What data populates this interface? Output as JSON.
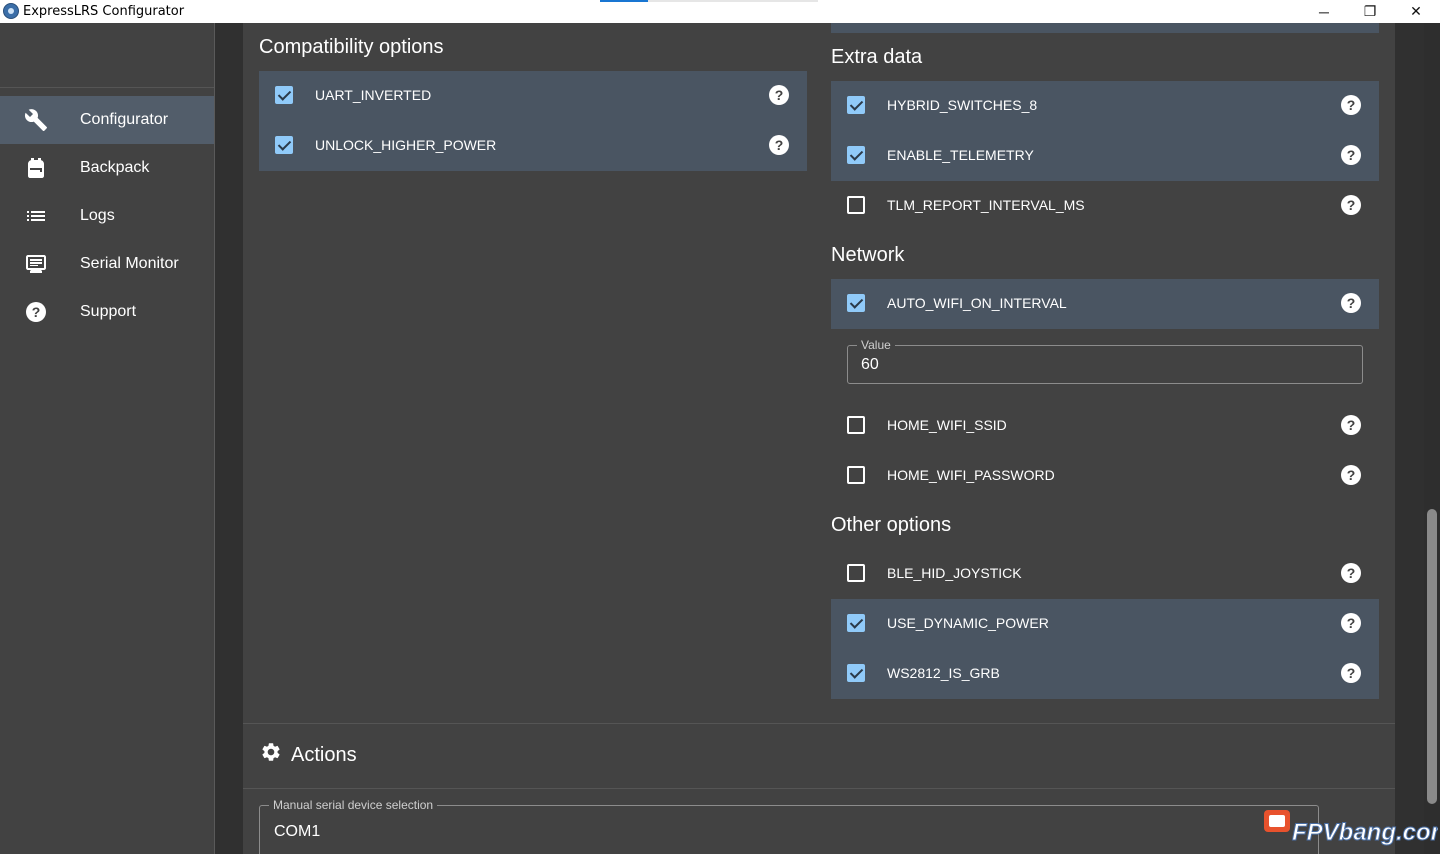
{
  "window": {
    "title": "ExpressLRS Configurator",
    "minimize": "─",
    "maximize": "❐",
    "close": "✕"
  },
  "sidebar": {
    "items": [
      {
        "label": "Configurator",
        "icon": "wrench-icon",
        "active": true
      },
      {
        "label": "Backpack",
        "icon": "backpack-icon",
        "active": false
      },
      {
        "label": "Logs",
        "icon": "list-icon",
        "active": false
      },
      {
        "label": "Serial Monitor",
        "icon": "monitor-icon",
        "active": false
      },
      {
        "label": "Support",
        "icon": "help-circle-icon",
        "active": false
      }
    ]
  },
  "compatibility": {
    "title": "Compatibility options",
    "options": [
      {
        "label": "UART_INVERTED",
        "checked": true
      },
      {
        "label": "UNLOCK_HIGHER_POWER",
        "checked": true
      }
    ]
  },
  "extra_data": {
    "title": "Extra data",
    "options": [
      {
        "label": "HYBRID_SWITCHES_8",
        "checked": true
      },
      {
        "label": "ENABLE_TELEMETRY",
        "checked": true
      },
      {
        "label": "TLM_REPORT_INTERVAL_MS",
        "checked": false
      }
    ]
  },
  "network": {
    "title": "Network",
    "options": [
      {
        "label": "AUTO_WIFI_ON_INTERVAL",
        "checked": true
      },
      {
        "label": "HOME_WIFI_SSID",
        "checked": false
      },
      {
        "label": "HOME_WIFI_PASSWORD",
        "checked": false
      }
    ],
    "value_field": {
      "legend": "Value",
      "value": "60"
    }
  },
  "other": {
    "title": "Other options",
    "options": [
      {
        "label": "BLE_HID_JOYSTICK",
        "checked": false
      },
      {
        "label": "USE_DYNAMIC_POWER",
        "checked": true
      },
      {
        "label": "WS2812_IS_GRB",
        "checked": true
      }
    ]
  },
  "actions": {
    "title": "Actions",
    "serial_field": {
      "legend": "Manual serial device selection",
      "value": "COM1"
    }
  },
  "help_glyph": "?",
  "watermark": {
    "text": "FPVbang.com"
  },
  "colors": {
    "sidebar_bg": "#424242",
    "active_item_bg": "#525d6a",
    "panel_bg": "#4a5562",
    "checkbox_accent": "#90caf9",
    "app_bg": "#303030"
  }
}
